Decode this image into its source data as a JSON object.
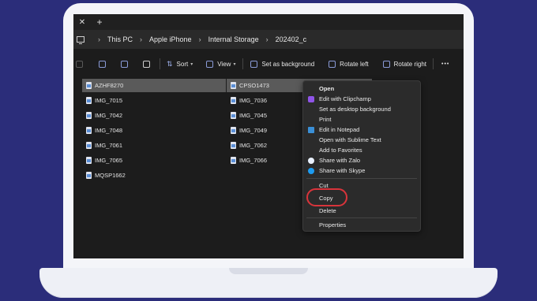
{
  "titlebar": {
    "close_glyph": "✕",
    "add_glyph": "+"
  },
  "breadcrumbs": [
    "This PC",
    "Apple iPhone",
    "Internal Storage",
    "202402_c"
  ],
  "toolbar": {
    "sort": "Sort",
    "view": "View",
    "set_background": "Set as background",
    "rotate_left": "Rotate left",
    "rotate_right": "Rotate right",
    "more": "•••"
  },
  "files": {
    "col1": [
      "AZHF8270",
      "IMG_7015",
      "IMG_7042",
      "IMG_7048",
      "IMG_7061",
      "IMG_7065",
      "MQSP1662"
    ],
    "col2": [
      "CPSO1473",
      "IMG_7036",
      "IMG_7045",
      "IMG_7049",
      "IMG_7062",
      "IMG_7066"
    ]
  },
  "context_menu": {
    "open": "Open",
    "edit_clipchamp": "Edit with Clipchamp",
    "set_desktop_background": "Set as desktop background",
    "print": "Print",
    "edit_notepad": "Edit in Notepad",
    "open_sublime": "Open with Sublime Text",
    "add_favorites": "Add to Favorites",
    "share_zalo": "Share with Zalo",
    "share_skype": "Share with Skype",
    "cut": "Cut",
    "copy": "Copy",
    "delete": "Delete",
    "properties": "Properties"
  },
  "colors": {
    "background": "#2b2d7a",
    "highlight_ring": "#d9343b",
    "accent": "#5b8fd6"
  }
}
